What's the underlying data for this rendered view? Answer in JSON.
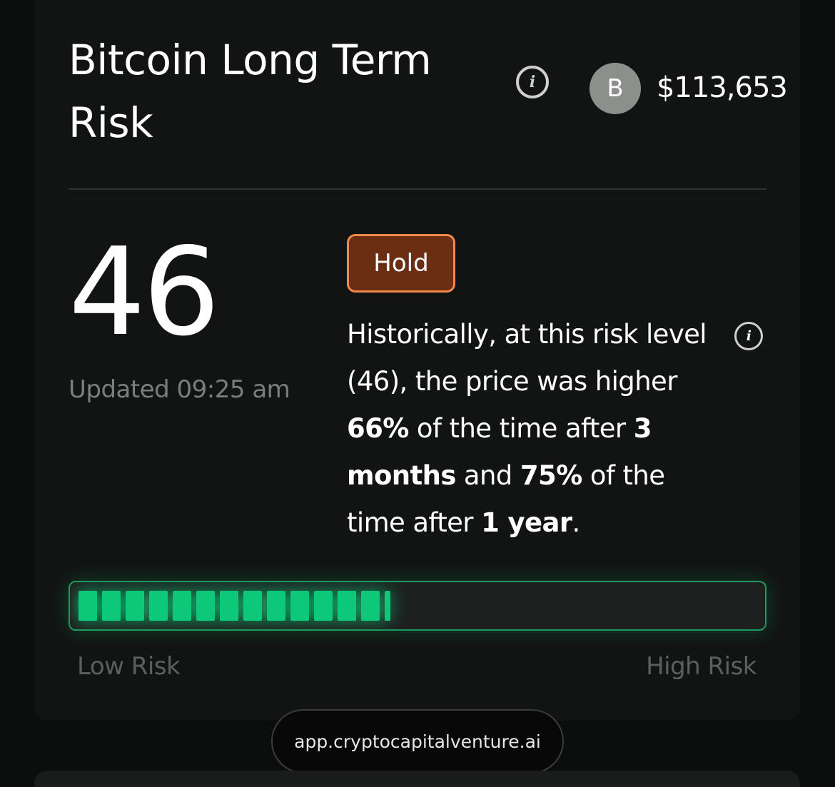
{
  "card": {
    "title": "Bitcoin Long Term Risk",
    "avatar_letter": "B",
    "price": "$113,653"
  },
  "risk": {
    "score": "46",
    "updated": "Updated 09:25 am",
    "badge": "Hold",
    "badge_color": "#6b2e12",
    "badge_border_color": "#f08a4b",
    "description": {
      "part1": "Historically, at this risk level (46), the price was higher ",
      "pct_3m": "66%",
      "part2": " of the time after ",
      "period_3m": "3 months",
      "part3": " and ",
      "pct_1y": "75%",
      "part4": " of the time after ",
      "period_1y": "1 year",
      "part5": "."
    },
    "level_fraction": 0.46,
    "bar_color": "#0cc878",
    "low_label": "Low Risk",
    "high_label": "High Risk"
  },
  "footer": {
    "url": "app.cryptocapitalventure.ai"
  },
  "icons": [
    "info-icon",
    "avatar"
  ]
}
